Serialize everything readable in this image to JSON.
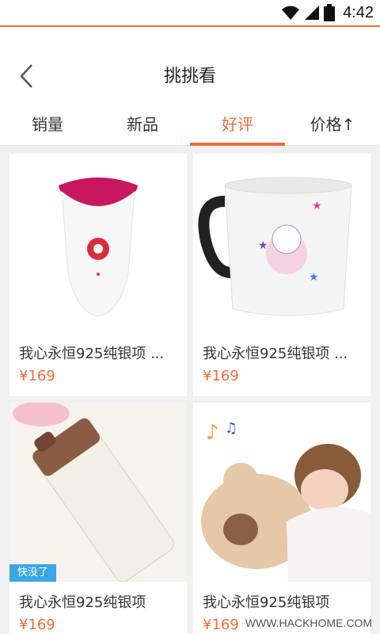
{
  "status_bar": {
    "time": "4:42",
    "icons": [
      "wifi-icon",
      "signal-icon",
      "battery-icon"
    ]
  },
  "nav": {
    "title": "挑挑看",
    "back_icon": "chevron-left-icon"
  },
  "tabs": [
    {
      "label": "销量",
      "active": false
    },
    {
      "label": "新品",
      "active": false
    },
    {
      "label": "好评",
      "active": true
    },
    {
      "label": "价格↑",
      "active": false
    }
  ],
  "products": [
    {
      "name": "我心永恒925纯银项 ...",
      "price": "¥169",
      "image": "epilator-product-image"
    },
    {
      "name": "我心永恒925纯银项 ...",
      "price": "¥169",
      "image": "mug-product-image"
    },
    {
      "name": "我心永恒925纯银项",
      "price": "¥169",
      "image": "thermos-product-image",
      "badge": "快没了"
    },
    {
      "name": "我心永恒925纯银项",
      "price": "¥169",
      "image": "bear-pillow-product-image"
    }
  ],
  "watermark": "WWW.HACKHOME.COM",
  "colors": {
    "accent": "#f26b3a",
    "badge": "#3aa6e6",
    "background": "#f0f0f0"
  }
}
